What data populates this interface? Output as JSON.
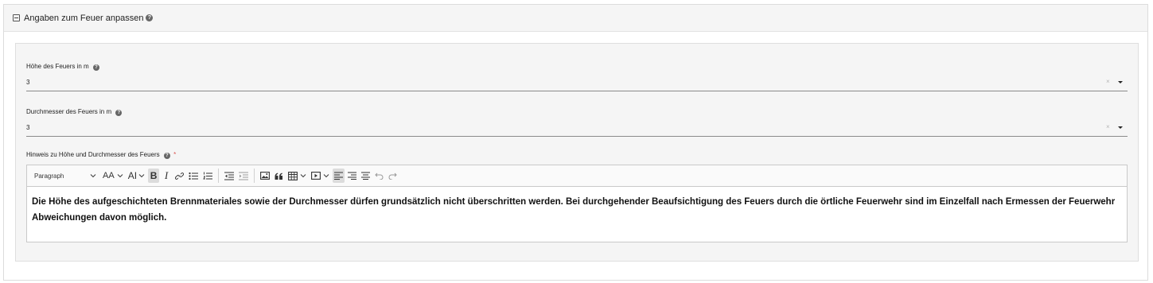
{
  "section": {
    "title": "Angaben zum Feuer anpassen"
  },
  "fields": {
    "hoehe": {
      "label": "Höhe des Feuers in m",
      "value": "3"
    },
    "durchmesser": {
      "label": "Durchmesser des Feuers in m",
      "value": "3"
    },
    "hinweis": {
      "label": "Hinweis zu Höhe und Durchmesser des Feuers",
      "required_mark": "*",
      "content": "Die Höhe des aufgeschichteten Brennmateriales sowie der Durchmesser dürfen grundsätzlich nicht überschritten werden. Bei durchgehender Beaufsichtigung des Feuers durch die örtliche Feuerwehr sind im Einzelfall nach Ermessen der Feuerwehr Abweichungen davon möglich."
    }
  },
  "common": {
    "clear_symbol": "×",
    "help_symbol": "?"
  },
  "toolbar": {
    "heading_select": "Paragraph",
    "font_size_glyph": "AA",
    "font_family_glyph": "AI",
    "bold_glyph": "B",
    "italic_glyph": "I"
  }
}
